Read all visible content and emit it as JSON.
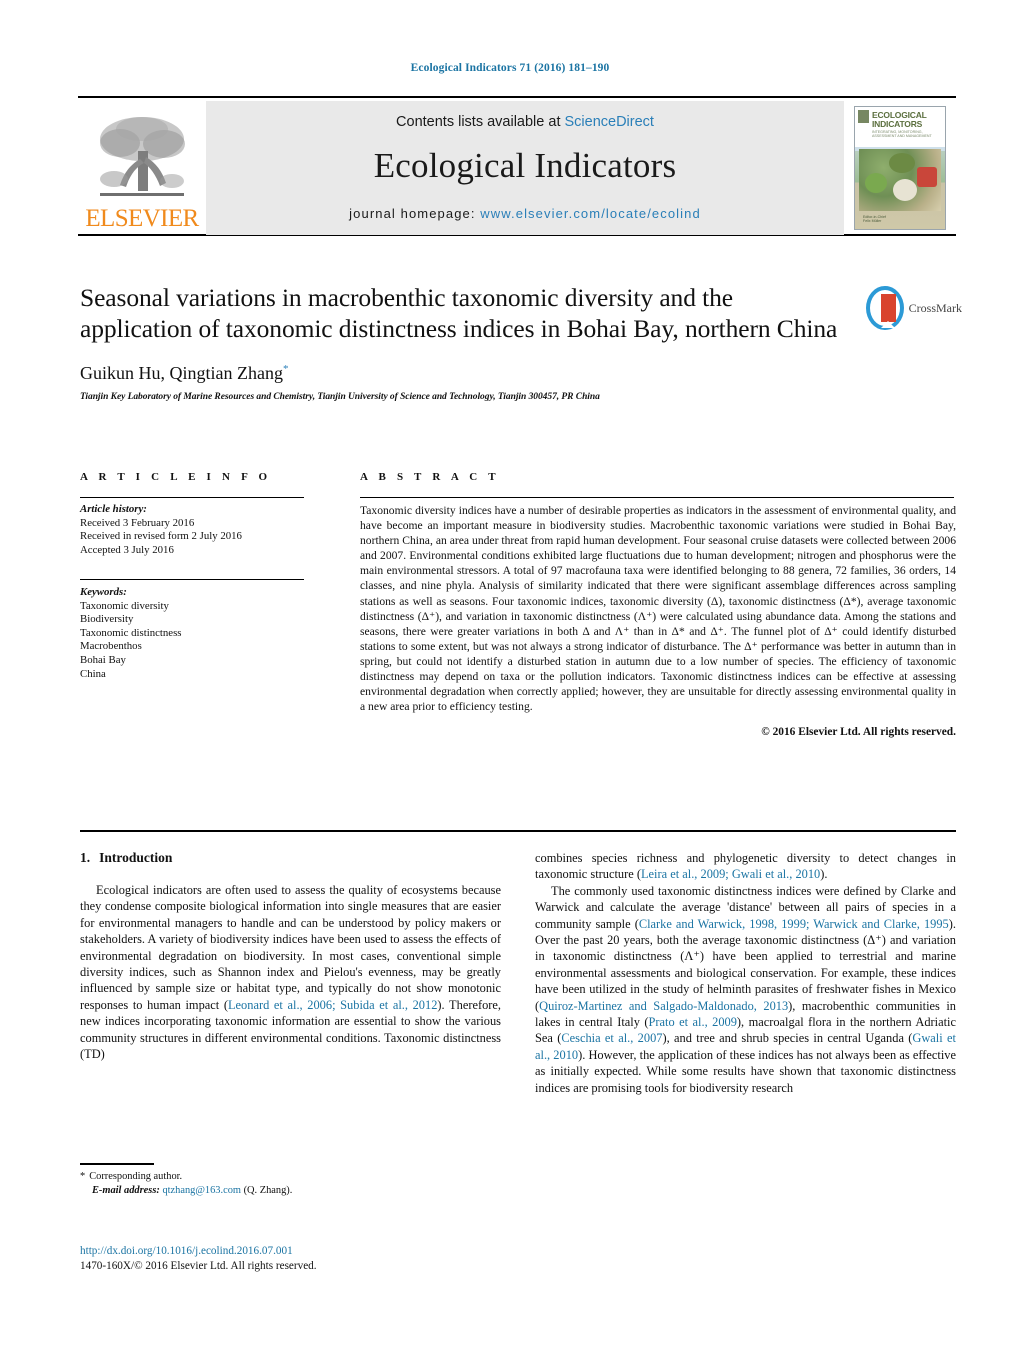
{
  "running_head": "Ecological Indicators 71 (2016) 181–190",
  "masthead": {
    "contents_prefix": "Contents lists available at ",
    "contents_link": "ScienceDirect",
    "journal_title": "Ecological Indicators",
    "homepage_prefix": "journal homepage: ",
    "homepage_url": "www.elsevier.com/locate/ecolind",
    "publisher": "ELSEVIER",
    "cover": {
      "title_line1": "ECOLOGICAL",
      "title_line2": "INDICATORS",
      "subtitle": "INTEGRATING, MONITORING, ASSESSMENT AND MANAGEMENT",
      "footer_line1": "Editor-in-Chief",
      "footer_line2": "Felix Müller"
    }
  },
  "article": {
    "title": "Seasonal variations in macrobenthic taxonomic diversity and the application of taxonomic distinctness indices in Bohai Bay, northern China",
    "authors": "Guikun Hu, Qingtian Zhang",
    "author_marker": "*",
    "affiliation": "Tianjin Key Laboratory of Marine Resources and Chemistry, Tianjin University of Science and Technology, Tianjin 300457, PR China",
    "crossmark_label": "CrossMark"
  },
  "article_info": {
    "heading": "A R T I C L E   I N F O",
    "history_label": "Article history:",
    "history": [
      "Received 3 February 2016",
      "Received in revised form 2 July 2016",
      "Accepted 3 July 2016"
    ],
    "keywords_label": "Keywords:",
    "keywords": [
      "Taxonomic diversity",
      "Biodiversity",
      "Taxonomic distinctness",
      "Macrobenthos",
      "Bohai Bay",
      "China"
    ]
  },
  "abstract": {
    "heading": "A B S T R A C T",
    "text": "Taxonomic diversity indices have a number of desirable properties as indicators in the assessment of environmental quality, and have become an important measure in biodiversity studies. Macrobenthic taxonomic variations were studied in Bohai Bay, northern China, an area under threat from rapid human development. Four seasonal cruise datasets were collected between 2006 and 2007. Environmental conditions exhibited large fluctuations due to human development; nitrogen and phosphorus were the main environmental stressors. A total of 97 macrofauna taxa were identified belonging to 88 genera, 72 families, 36 orders, 14 classes, and nine phyla. Analysis of similarity indicated that there were significant assemblage differences across sampling stations as well as seasons. Four taxonomic indices, taxonomic diversity (Δ), taxonomic distinctness (Δ*), average taxonomic distinctness (Δ⁺), and variation in taxonomic distinctness (Λ⁺) were calculated using abundance data. Among the stations and seasons, there were greater variations in both Δ and Λ⁺ than in Δ* and Δ⁺. The funnel plot of Δ⁺ could identify disturbed stations to some extent, but was not always a strong indicator of disturbance. The Δ⁺ performance was better in autumn than in spring, but could not identify a disturbed station in autumn due to a low number of species. The efficiency of taxonomic distinctness may depend on taxa or the pollution indicators. Taxonomic distinctness indices can be effective at assessing environmental degradation when correctly applied; however, they are unsuitable for directly assessing environmental quality in a new area prior to efficiency testing.",
    "copyright": "© 2016 Elsevier Ltd. All rights reserved."
  },
  "section": {
    "number": "1.",
    "title": "Introduction"
  },
  "body": {
    "left_p1_a": "Ecological indicators are often used to assess the quality of ecosystems because they condense composite biological information into single measures that are easier for environmental managers to handle and can be understood by policy makers or stakeholders. A variety of biodiversity indices have been used to assess the effects of environmental degradation on biodiversity. In most cases, conventional simple diversity indices, such as Shannon index and Pielou's evenness, may be greatly influenced by sample size or habitat type, and typically do not show monotonic responses to human impact (",
    "left_p1_ref1": "Leonard et al., 2006; Subida et al., 2012",
    "left_p1_b": "). Therefore, new indices incorporating taxonomic information are essential to show the various community structures in different environmental conditions. Taxonomic distinctness (TD)",
    "right_p1_a": "combines species richness and phylogenetic diversity to detect changes in taxonomic structure (",
    "right_p1_ref1": "Leira et al., 2009; Gwali et al., 2010",
    "right_p1_b": ").",
    "right_p2_a": "The commonly used taxonomic distinctness indices were defined by Clarke and Warwick and calculate the average 'distance' between all pairs of species in a community sample (",
    "right_p2_ref1": "Clarke and Warwick, 1998, 1999; Warwick and Clarke, 1995",
    "right_p2_b": "). Over the past 20 years, both the average taxonomic distinctness (Δ⁺) and variation in taxonomic distinctness (Λ⁺) have been applied to terrestrial and marine environmental assessments and biological conservation. For example, these indices have been utilized in the study of helminth parasites of freshwater fishes in Mexico (",
    "right_p2_ref2": "Quiroz-Martinez and Salgado-Maldonado, 2013",
    "right_p2_c": "), macrobenthic communities in lakes in central Italy (",
    "right_p2_ref3": "Prato et al., 2009",
    "right_p2_d": "), macroalgal flora in the northern Adriatic Sea (",
    "right_p2_ref4": "Ceschia et al., 2007",
    "right_p2_e": "), and tree and shrub species in central Uganda (",
    "right_p2_ref5": "Gwali et al., 2010",
    "right_p2_f": "). However, the application of these indices has not always been as effective as initially expected. While some results have shown that taxonomic distinctness indices are promising tools for biodiversity research"
  },
  "footnote": {
    "marker": "*",
    "corresponding": "Corresponding author.",
    "email_label": "E-mail address:",
    "email": "qtzhang@163.com",
    "email_suffix": " (Q. Zhang)."
  },
  "imprint": {
    "doi": "http://dx.doi.org/10.1016/j.ecolind.2016.07.001",
    "issn_line": "1470-160X/© 2016 Elsevier Ltd. All rights reserved."
  },
  "colors": {
    "link": "#1b74a3",
    "elsevier_orange": "#f08a1c",
    "crossmark_blue": "#2c9ad6",
    "crossmark_red": "#d9442e"
  }
}
